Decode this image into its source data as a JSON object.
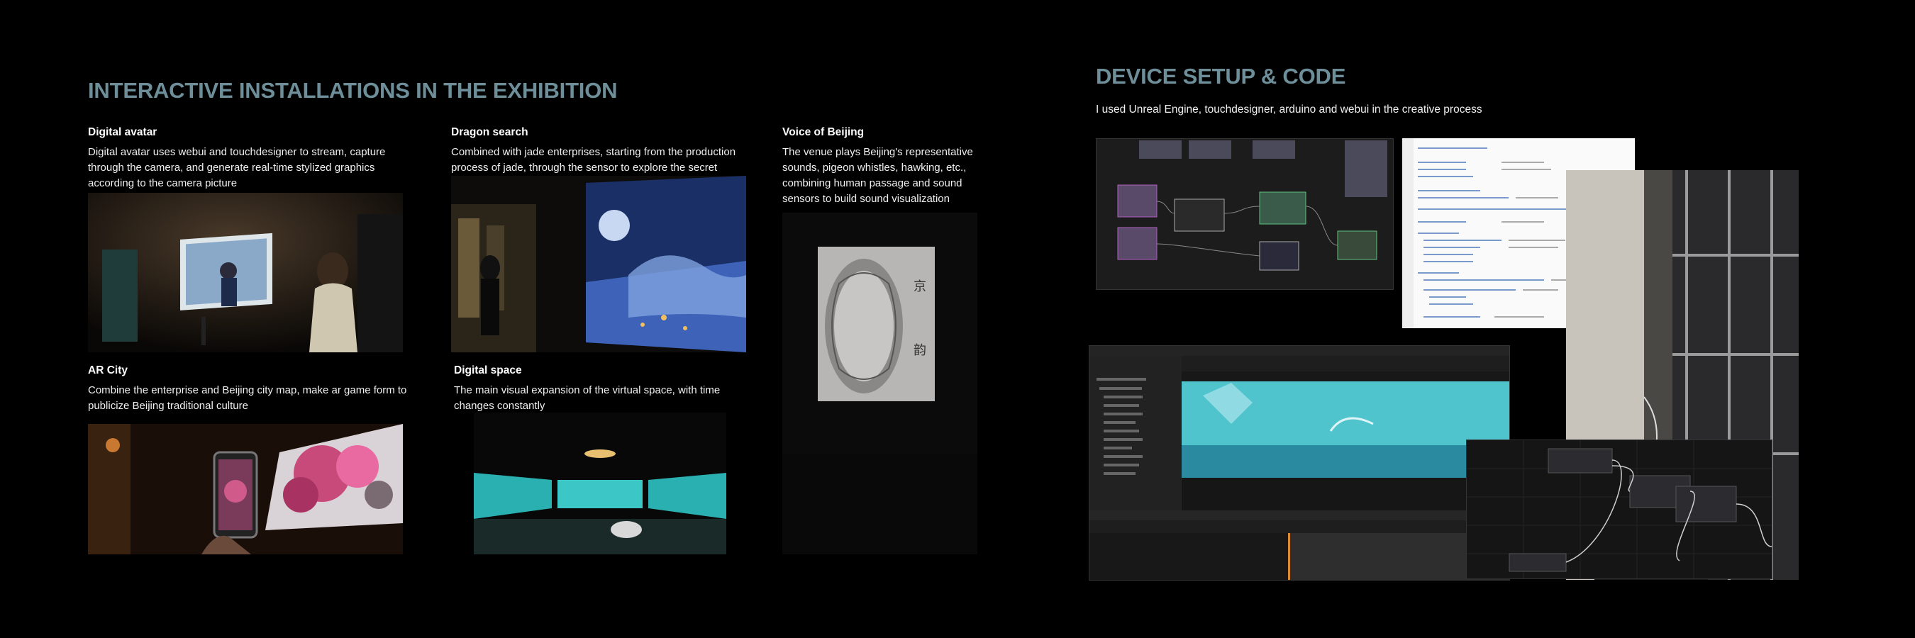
{
  "left_section": {
    "title": "INTERACTIVE INSTALLATIONS IN THE EXHIBITION",
    "cards": [
      {
        "title": "Digital avatar",
        "description": "Digital avatar uses webui and touchdesigner to stream, capture through the camera, and generate real-time stylized graphics according to the camera picture"
      },
      {
        "title": "Dragon search",
        "description": "Combined with jade enterprises, starting from the production process of jade, through the sensor to explore the secret behind the jade"
      },
      {
        "title": "Voice of Beijing",
        "description": "The venue plays Beijing's representative sounds, pigeon whistles, hawking, etc., combining human passage and sound sensors to build sound visualization"
      },
      {
        "title": "AR City",
        "description": "Combine the enterprise and Beijing city map, make ar game form to publicize Beijing traditional culture"
      },
      {
        "title": "Digital space",
        "description": "The main visual expansion of the virtual space, with time changes constantly"
      }
    ]
  },
  "right_section": {
    "title": "DEVICE SETUP & CODE",
    "subtitle": "I used Unreal Engine, touchdesigner, arduino and webui in the creative process"
  },
  "colors": {
    "background": "#000000",
    "heading": "#6e8f99",
    "text": "#ffffff"
  }
}
